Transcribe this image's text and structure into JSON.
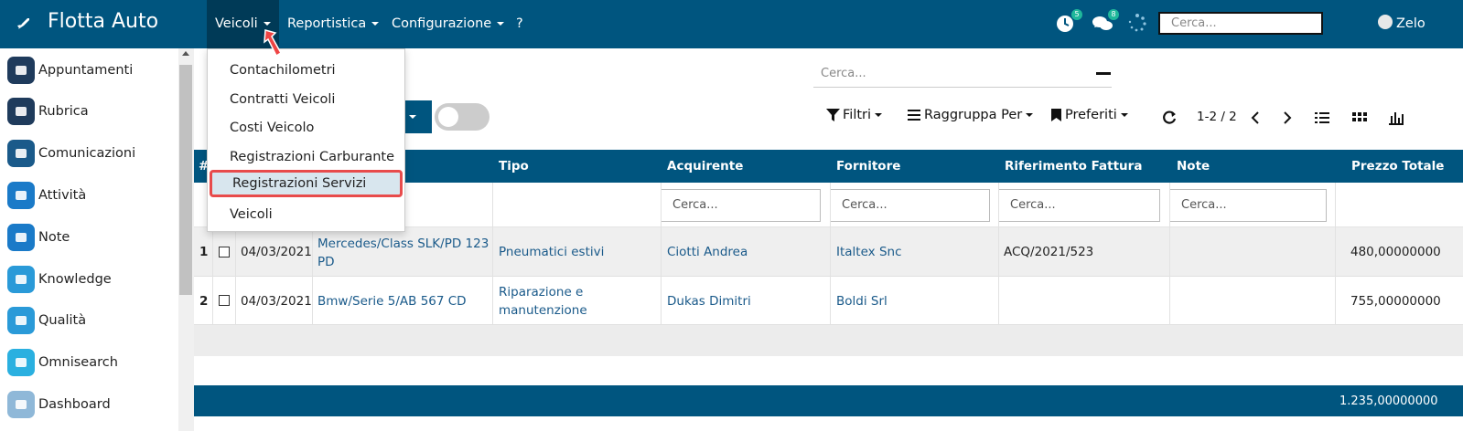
{
  "app": {
    "title": "Flotta Auto"
  },
  "nav": {
    "veicoli": "Veicoli",
    "reportistica": "Reportistica",
    "configurazione": "Configurazione",
    "help": "?"
  },
  "topbar": {
    "activities_badge": "5",
    "messages_badge": "8",
    "search_placeholder": "Cerca...",
    "user": "Zelo"
  },
  "sidebar": {
    "items": [
      {
        "label": "Appuntamenti",
        "icon": "calendar-icon",
        "color": "#1f3b5c"
      },
      {
        "label": "Rubrica",
        "icon": "contacts-icon",
        "color": "#1f3b5c"
      },
      {
        "label": "Comunicazioni",
        "icon": "chat-icon",
        "color": "#1a5a8a"
      },
      {
        "label": "Attività",
        "icon": "check-icon",
        "color": "#1a7ac8"
      },
      {
        "label": "Note",
        "icon": "note-icon",
        "color": "#1a7ac8"
      },
      {
        "label": "Knowledge",
        "icon": "brain-icon",
        "color": "#2a9ad8"
      },
      {
        "label": "Qualità",
        "icon": "quality-icon",
        "color": "#2a9ad8"
      },
      {
        "label": "Omnisearch",
        "icon": "search-icon",
        "color": "#2ab0e0"
      },
      {
        "label": "Dashboard",
        "icon": "gauge-icon",
        "color": "#8fb8d8"
      }
    ]
  },
  "dropdown": {
    "items": [
      {
        "label": "Contachilometri"
      },
      {
        "label": "Contratti Veicoli"
      },
      {
        "label": "Costi Veicolo"
      },
      {
        "label": "Registrazioni Carburante"
      },
      {
        "label": "Registrazioni Servizi"
      },
      {
        "label": "Veicoli"
      }
    ]
  },
  "toolbar": {
    "search_placeholder": "Cerca...",
    "filters": "Filtri",
    "group_by": "Raggruppa Per",
    "favorites": "Preferiti",
    "pager": "1-2 / 2"
  },
  "table": {
    "headers": {
      "index": "#",
      "tipo": "Tipo",
      "acquirente": "Acquirente",
      "fornitore": "Fornitore",
      "riferimento": "Riferimento Fattura",
      "note": "Note",
      "prezzo": "Prezzo Totale"
    },
    "filter_placeholder": "Cerca...",
    "rows": [
      {
        "index": "1",
        "date": "04/03/2021",
        "vehicle_line1": "Mercedes/Class SLK/PD 123",
        "vehicle_line2": "PD",
        "tipo_line1": "Pneumatici estivi",
        "tipo_line2": "",
        "acquirente": "Ciotti Andrea",
        "fornitore": "Italtex Snc",
        "riferimento": "ACQ/2021/523",
        "note": "",
        "prezzo": "480,00000000"
      },
      {
        "index": "2",
        "date": "04/03/2021",
        "vehicle_line1": "Bmw/Serie 5/AB 567 CD",
        "vehicle_line2": "",
        "tipo_line1": "Riparazione e",
        "tipo_line2": "manutenzione",
        "acquirente": "Dukas Dimitri",
        "fornitore": "Boldi Srl",
        "riferimento": "",
        "note": "",
        "prezzo": "755,00000000"
      }
    ],
    "total": "1.235,00000000"
  },
  "colors": {
    "primary": "#00557f",
    "highlight_border": "#e84b4b",
    "link": "#1a5a8a"
  }
}
